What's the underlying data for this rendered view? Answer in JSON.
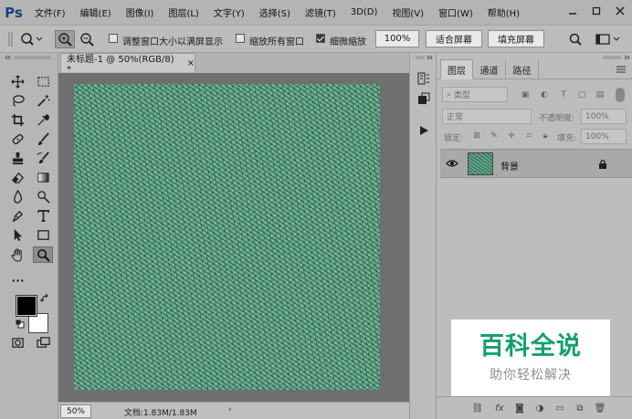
{
  "app": {
    "logo": "Ps",
    "menus": [
      "文件(F)",
      "编辑(E)",
      "图像(I)",
      "图层(L)",
      "文字(Y)",
      "选择(S)",
      "滤镜(T)",
      "3D(D)",
      "视图(V)",
      "窗口(W)",
      "帮助(H)"
    ]
  },
  "options": {
    "resize_windows_label": "调整窗口大小以满屏显示",
    "resize_windows_checked": false,
    "zoom_all_label": "缩放所有窗口",
    "zoom_all_checked": false,
    "scrubby_label": "细微缩放",
    "scrubby_checked": true,
    "percent_button": "100%",
    "fit_screen_button": "适合屏幕",
    "fill_screen_button": "填充屏幕"
  },
  "document": {
    "tab_title": "未标题-1 @ 50%(RGB/8) *",
    "tab_close": "×",
    "canvas_color": "#5fa68a",
    "zoom": "50%",
    "doc_size": "文档:1.83M/1.83M",
    "status_arrow": "›"
  },
  "tools": {
    "active": "zoom-tool",
    "foreground_color": "#000000",
    "background_color": "#ffffff"
  },
  "layers_panel": {
    "tabs": [
      "图层",
      "通道",
      "路径"
    ],
    "active_tab": 0,
    "filter_kind": "类型",
    "blend_mode": "正常",
    "opacity_label": "不透明度:",
    "opacity_value": "100%",
    "lock_label": "锁定:",
    "fill_label": "填充:",
    "fill_value": "100%",
    "layers": [
      {
        "name": "背景",
        "visible": true,
        "locked": true
      }
    ]
  },
  "watermark": {
    "title": "百科全说",
    "subtitle": "助你轻松解决"
  }
}
